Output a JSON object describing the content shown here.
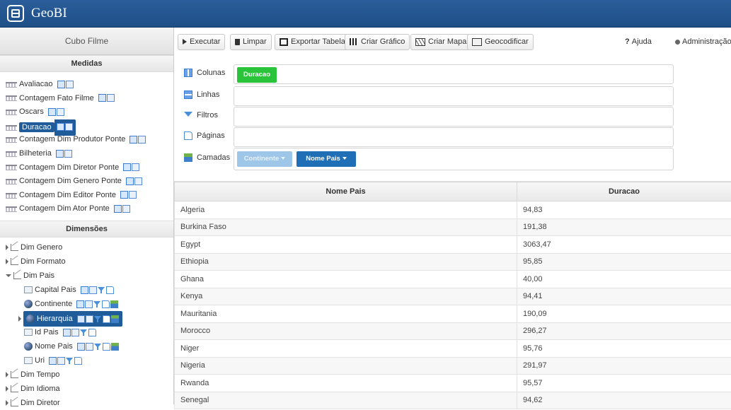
{
  "app": {
    "title": "GeoBI"
  },
  "cube": {
    "title": "Cubo Filme"
  },
  "measures": {
    "header": "Medidas",
    "items": [
      {
        "label": "Avaliacao",
        "selected": false
      },
      {
        "label": "Contagem Fato Filme",
        "selected": false
      },
      {
        "label": "Oscars",
        "selected": false
      },
      {
        "label": "Duracao",
        "selected": true
      },
      {
        "label": "Contagem Dim Produtor Ponte",
        "selected": false
      },
      {
        "label": "Bilheteria",
        "selected": false
      },
      {
        "label": "Contagem Dim Diretor Ponte",
        "selected": false
      },
      {
        "label": "Contagem Dim Genero Ponte",
        "selected": false
      },
      {
        "label": "Contagem Dim Editor Ponte",
        "selected": false
      },
      {
        "label": "Contagem Dim Ator Ponte",
        "selected": false
      }
    ]
  },
  "dimensions": {
    "header": "Dimensões",
    "items": [
      {
        "label": "Dim Genero"
      },
      {
        "label": "Dim Formato"
      },
      {
        "label": "Dim Pais"
      },
      {
        "label": "Capital Pais"
      },
      {
        "label": "Continente"
      },
      {
        "label": "Hierarquia"
      },
      {
        "label": "Id Pais"
      },
      {
        "label": "Nome Pais"
      },
      {
        "label": "Uri"
      },
      {
        "label": "Dim Tempo"
      },
      {
        "label": "Dim Idioma"
      },
      {
        "label": "Dim Diretor"
      }
    ]
  },
  "toolbar": {
    "executar": "Executar",
    "limpar": "Limpar",
    "exportar": "Exportar Tabela",
    "grafico": "Criar Gráfico",
    "mapa": "Criar Mapa",
    "geocodificar": "Geocodificar",
    "ajuda_mark": "?",
    "ajuda": "Ajuda",
    "admin": "Administração"
  },
  "pivot": {
    "colunas": {
      "label": "Colunas",
      "chips": [
        "Duracao"
      ]
    },
    "linhas": {
      "label": "Linhas"
    },
    "filtros": {
      "label": "Filtros"
    },
    "paginas": {
      "label": "Páginas"
    },
    "camadas": {
      "label": "Camadas",
      "chips": [
        "Continente",
        "Nome Pais"
      ]
    }
  },
  "table": {
    "columns": [
      "Nome Pais",
      "Duracao"
    ],
    "rows": [
      [
        "Algeria",
        "94,83"
      ],
      [
        "Burkina Faso",
        "191,38"
      ],
      [
        "Egypt",
        "3063,47"
      ],
      [
        "Ethiopia",
        "95,85"
      ],
      [
        "Ghana",
        "40,00"
      ],
      [
        "Kenya",
        "94,41"
      ],
      [
        "Mauritania",
        "190,09"
      ],
      [
        "Morocco",
        "296,27"
      ],
      [
        "Niger",
        "95,76"
      ],
      [
        "Nigeria",
        "291,97"
      ],
      [
        "Rwanda",
        "95,57"
      ],
      [
        "Senegal",
        "94,62"
      ]
    ]
  },
  "colors": {
    "header_bg": "#1f4f87",
    "selected": "#1f5c99",
    "green_chip": "#29c43a",
    "blue_chip": "#1f6fb6"
  }
}
